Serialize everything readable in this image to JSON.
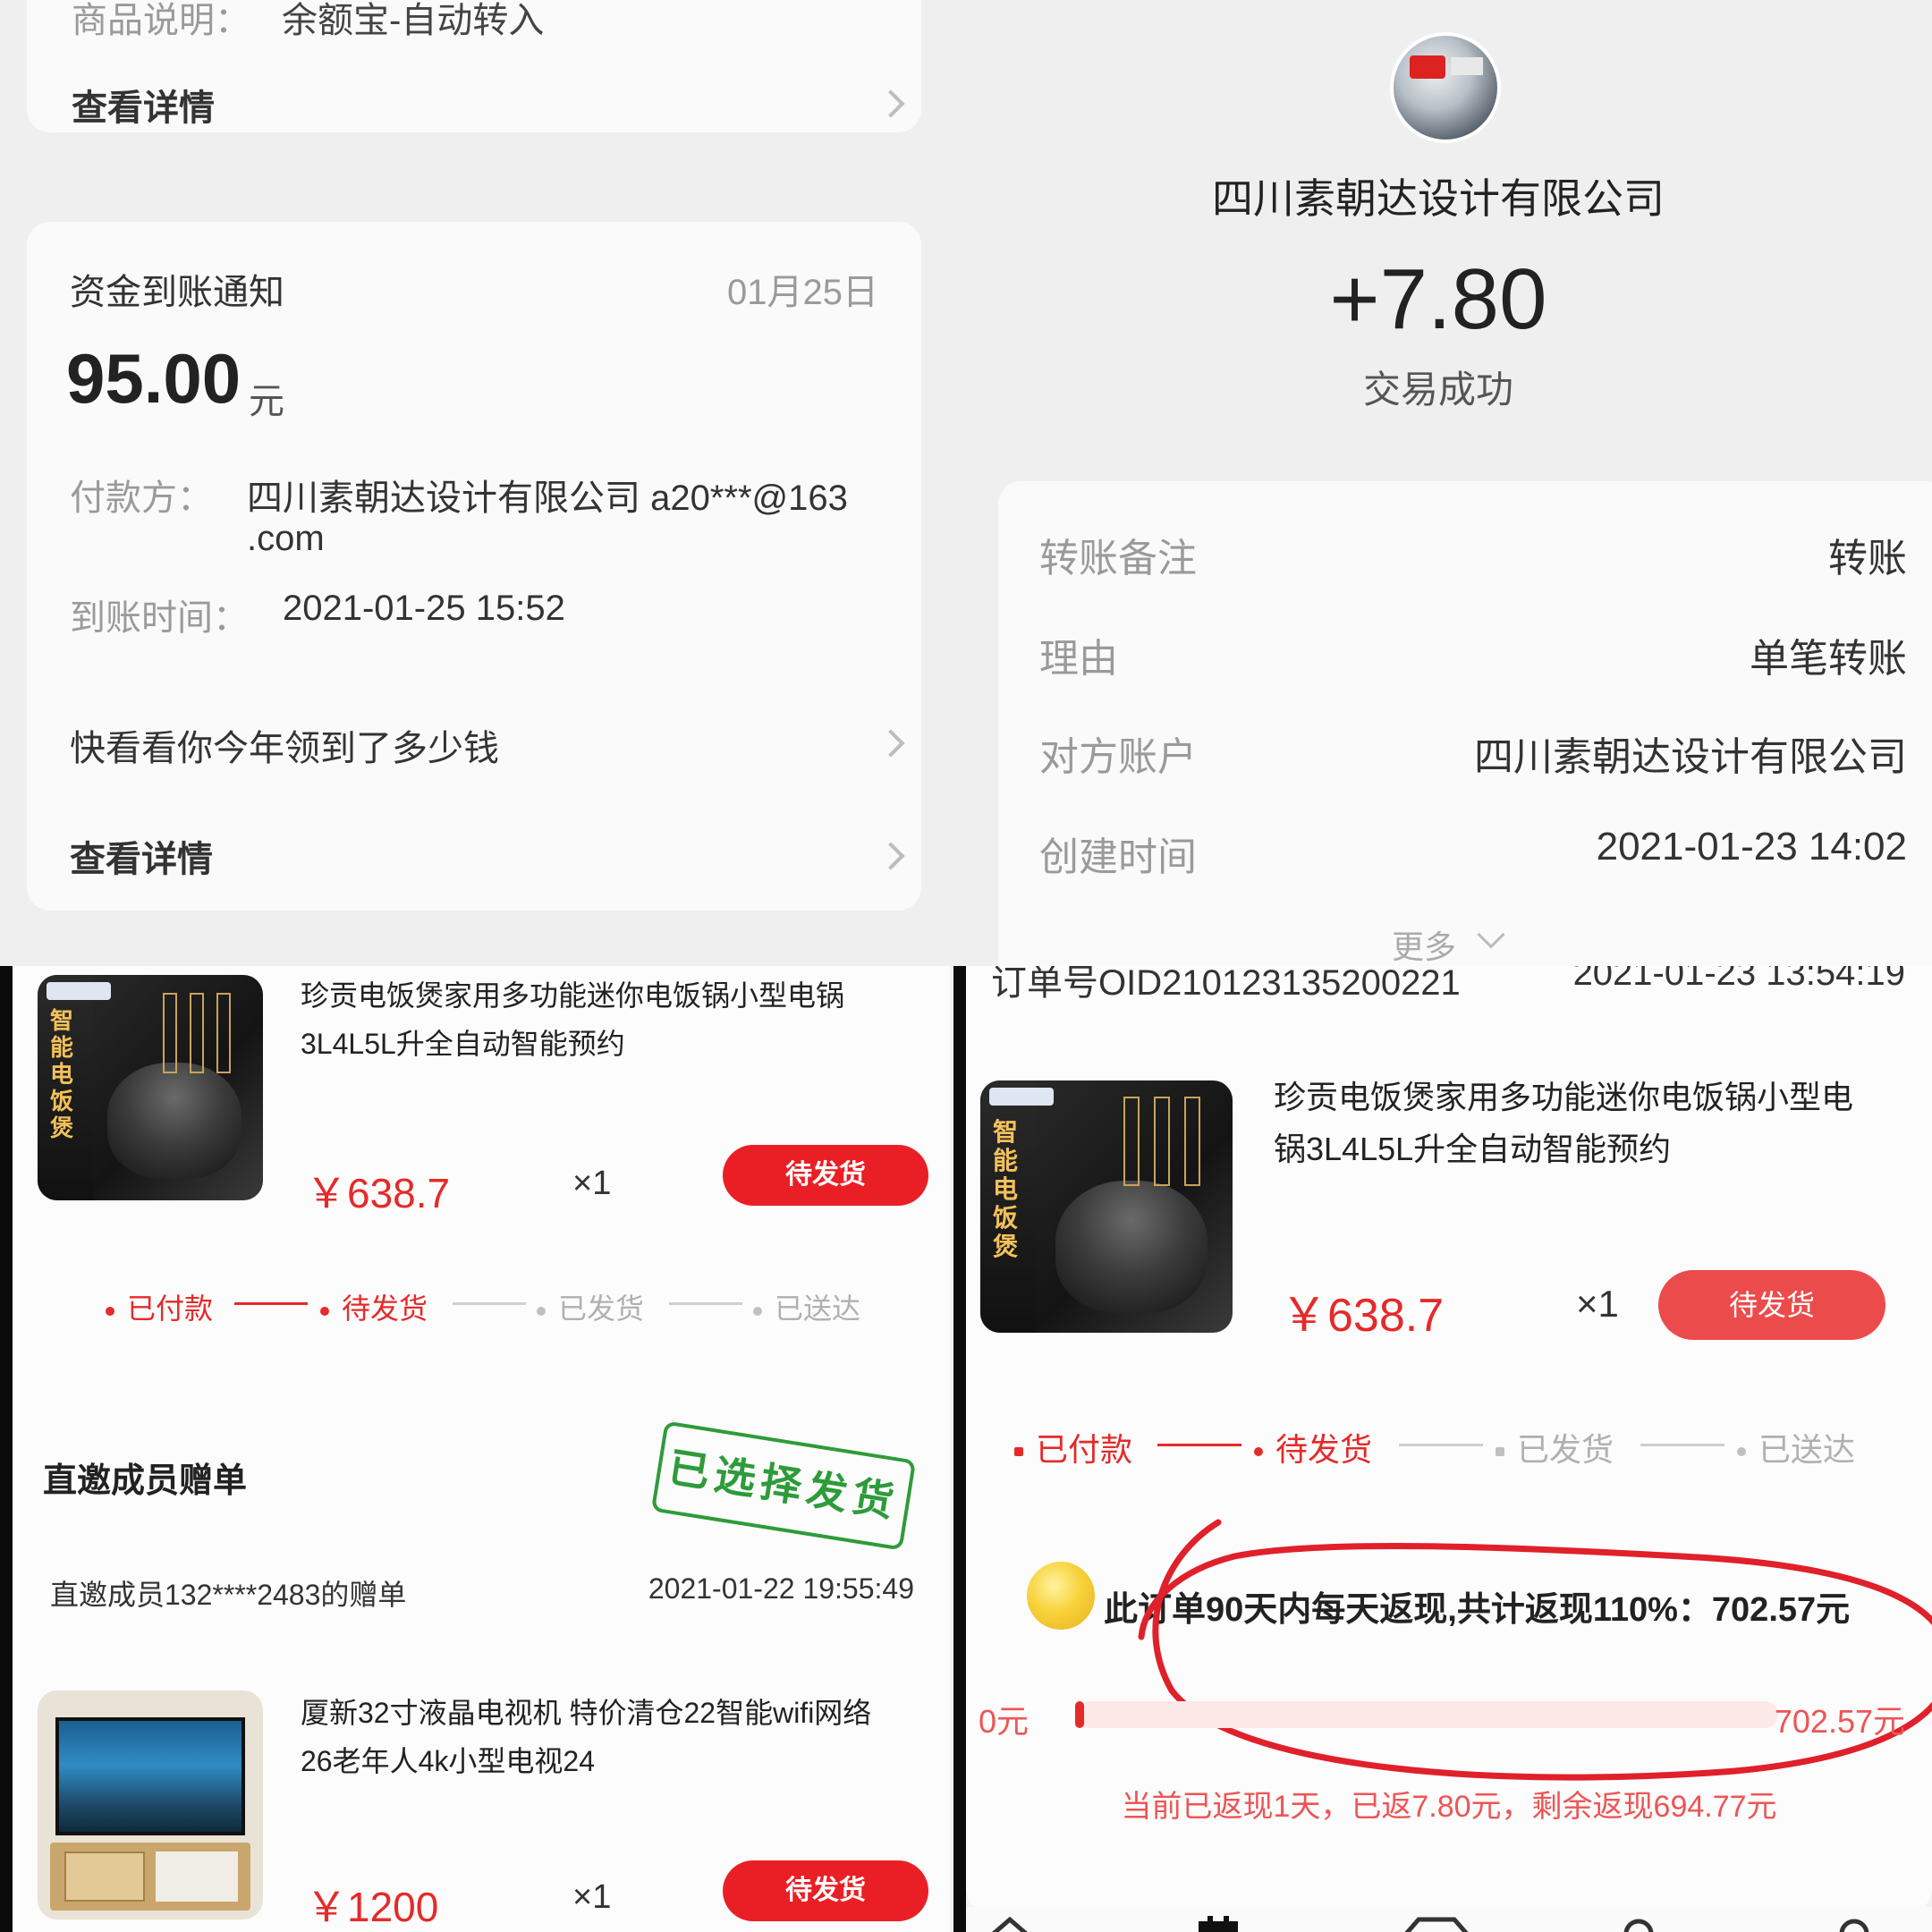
{
  "top_left": {
    "partial_header": {
      "label": "商品说明：",
      "value": "余额宝-自动转入"
    },
    "details_link_1": "查看详情",
    "notice": {
      "title": "资金到账通知",
      "date": "01月25日",
      "amount": "95.00",
      "currency": "元",
      "payer_label": "付款方：",
      "payer_value_line1": "四川素朝达设计有限公司 a20***@163",
      "payer_value_line2": ".com",
      "time_label": "到账时间：",
      "time_value": "2021-01-25 15:52",
      "promo_link": "快看看你今年领到了多少钱",
      "details_link_2": "查看详情"
    }
  },
  "top_right": {
    "company": "四川素朝达设计有限公司",
    "amount": "+7.80",
    "status": "交易成功",
    "rows": [
      {
        "label": "转账备注",
        "value": "转账"
      },
      {
        "label": "理由",
        "value": "单笔转账"
      },
      {
        "label": "对方账户",
        "value": "四川素朝达设计有限公司"
      },
      {
        "label": "创建时间",
        "value": "2021-01-23 14:02"
      }
    ],
    "more": "更多"
  },
  "bottom_left": {
    "product1": {
      "image_text": "智能电饭煲",
      "title_line1": "珍贡电饭煲家用多功能迷你电饭锅小型电锅",
      "title_line2": "3L4L5L升全自动智能预约",
      "price": "￥638.7",
      "qty": "×1",
      "status_button": "待发货"
    },
    "steps": [
      "已付款",
      "待发货",
      "已发货",
      "已送达"
    ],
    "section_title": "直邀成员赠单",
    "stamp": "已选择发货",
    "member_order": "直邀成员132****2483的赠单",
    "member_time": "2021-01-22 19:55:49",
    "product2": {
      "title_line1": "厦新32寸液晶电视机 特价清仓22智能wifi网络",
      "title_line2": "26老年人4k小型电视24",
      "price": "￥1200",
      "qty": "×1",
      "status_button": "待发货"
    }
  },
  "bottom_right": {
    "order_no_partial": "订单号OID210123135200221",
    "order_time_partial": "2021-01-23 13:54:19",
    "product": {
      "image_text": "智能电饭煲",
      "title_line1": "珍贡电饭煲家用多功能迷你电饭锅小型电",
      "title_line2": "锅3L4L5L升全自动智能预约",
      "price": "￥638.7",
      "qty": "×1",
      "status_button": "待发货"
    },
    "steps": [
      "已付款",
      "待发货",
      "已发货",
      "已送达"
    ],
    "cashback_text": "此订单90天内每天返现,共计返现110%：702.57元",
    "progress_min": "0元",
    "progress_max": "702.57元",
    "progress_fraction": 0.011,
    "cashback_status": "当前已返现1天，已返7.80元，剩余返现694.77元"
  },
  "colors": {
    "accent_red": "#e52a2a",
    "stamp_green": "#2e9b3a",
    "muted_gray": "#9a9a9a"
  },
  "bottom_nav_icons": [
    "home-icon",
    "orders-icon",
    "diamond-icon",
    "team-icon",
    "profile-icon"
  ]
}
